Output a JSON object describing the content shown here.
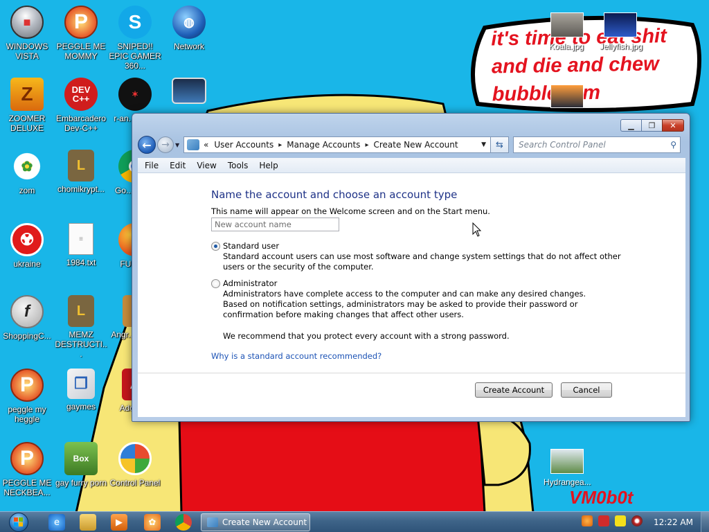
{
  "desktop": {
    "speech_text": "it's time to eat shit and die and chew bubblegum",
    "watermark": "VM0b0t",
    "icons": [
      {
        "label": "WINDOWS VISTA"
      },
      {
        "label": "PEGGLE ME MOMMY"
      },
      {
        "label": "SNIPED!! EPIC GAMER 360..."
      },
      {
        "label": "Network"
      },
      {
        "label": "ZOOMER DELUXE"
      },
      {
        "label": "Embarcadero Dev-C++"
      },
      {
        "label": "r-an... par..."
      },
      {
        "label": "zom"
      },
      {
        "label": "chomikrypt..."
      },
      {
        "label": "Go... Chr..."
      },
      {
        "label": "ukraine"
      },
      {
        "label": "1984.txt"
      },
      {
        "label": "FURR..."
      },
      {
        "label": "ShoppingC..."
      },
      {
        "label": "MEMZ DESTRUCTI..."
      },
      {
        "label": "Angr... Sea..."
      },
      {
        "label": "peggle my heggle"
      },
      {
        "label": "gaymes"
      },
      {
        "label": "Adobe..."
      },
      {
        "label": "PEGGLE ME NECKBEA..."
      },
      {
        "label": "gay furry porn"
      },
      {
        "label": "Control Panel"
      }
    ],
    "photos": [
      {
        "label": "Koala.jpg"
      },
      {
        "label": "Jellyfish.jpg"
      },
      {
        "label": "Hydrangea..."
      }
    ]
  },
  "window": {
    "nav": {
      "back_icon": "back-arrow-icon",
      "forward_icon": "forward-arrow-icon",
      "breadcrumb": [
        "User Accounts",
        "Manage Accounts",
        "Create New Account"
      ],
      "overflow": "«",
      "search_placeholder": "Search Control Panel"
    },
    "menu": [
      "File",
      "Edit",
      "View",
      "Tools",
      "Help"
    ],
    "content": {
      "heading": "Name the account and choose an account type",
      "description": "This name will appear on the Welcome screen and on the Start menu.",
      "name_placeholder": "New account name",
      "name_value": "",
      "options": [
        {
          "label": "Standard user",
          "selected": true,
          "description": "Standard account users can use most software and change system settings that do not affect other users or the security of the computer."
        },
        {
          "label": "Administrator",
          "selected": false,
          "description": "Administrators have complete access to the computer and can make any desired changes. Based on notification settings, administrators may be asked to provide their password or confirmation before making changes that affect other users."
        }
      ],
      "recommendation": "We recommend that you protect every account with a strong password.",
      "help_link": "Why is a standard account recommended?",
      "create_button": "Create Account",
      "cancel_button": "Cancel"
    }
  },
  "taskbar": {
    "active_task": "Create New Account",
    "clock": "12:22 AM"
  },
  "colors": {
    "desktop_bg": "#19b6e8",
    "heading": "#1e3287",
    "link": "#1b52b5",
    "speech_text": "#e4131f"
  }
}
